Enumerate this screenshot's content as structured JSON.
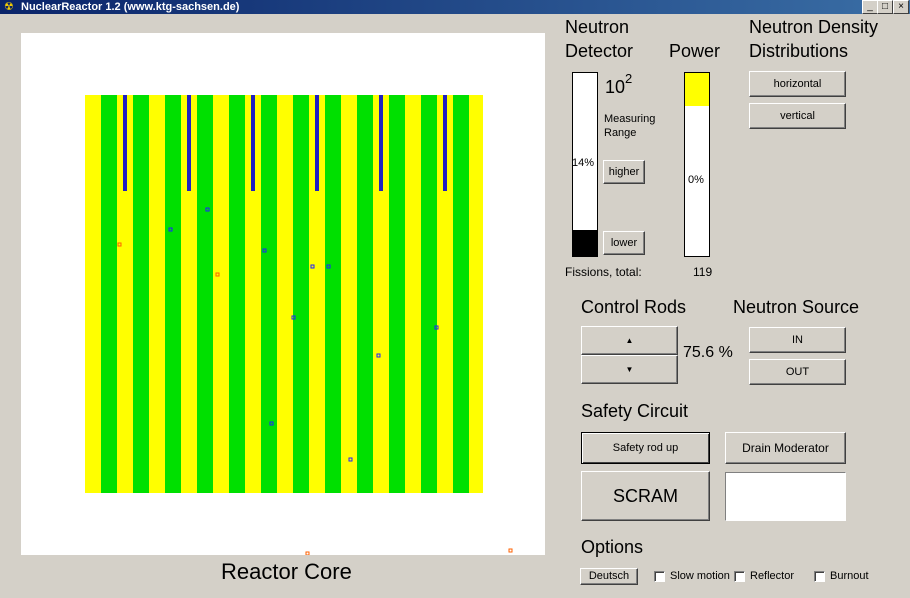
{
  "window": {
    "title": "NuclearReactor 1.2 (www.ktg-sachsen.de)",
    "app_icon": "radiation-icon"
  },
  "core": {
    "label": "Reactor Core",
    "colors": {
      "fuel": "#ffff00",
      "moderator": "#00e000",
      "control_rod": "#2020c0",
      "neutron_thermal": "#2020ff",
      "neutron_fast": "#ff6000"
    }
  },
  "detector": {
    "heading_line1": "Neutron",
    "heading_line2": "Detector",
    "range_base": "10",
    "range_exponent": "2",
    "range_label_line1": "Measuring",
    "range_label_line2": "Range",
    "reading": "14%",
    "reading_fraction": 0.14,
    "higher_label": "higher",
    "lower_label": "lower"
  },
  "power": {
    "heading": "Power",
    "reading": "0%",
    "indicator_fraction": 0.18
  },
  "fissions": {
    "label": "Fissions, total:",
    "value": "119"
  },
  "density": {
    "heading_line1": "Neutron Density",
    "heading_line2": "Distributions",
    "horizontal_label": "horizontal",
    "vertical_label": "vertical"
  },
  "control_rods": {
    "heading": "Control Rods",
    "up_glyph": "▲",
    "down_glyph": "▼",
    "position": "75.6 %"
  },
  "neutron_source": {
    "heading": "Neutron Source",
    "in_label": "IN",
    "out_label": "OUT"
  },
  "safety": {
    "heading": "Safety Circuit",
    "safety_rod_label": "Safety rod up",
    "drain_label": "Drain Moderator",
    "scram_label": "SCRAM",
    "status_text": ""
  },
  "options": {
    "heading": "Options",
    "language_label": "Deutsch",
    "slow_motion_label": "Slow motion",
    "reflector_label": "Reflector",
    "burnout_label": "Burnout"
  }
}
